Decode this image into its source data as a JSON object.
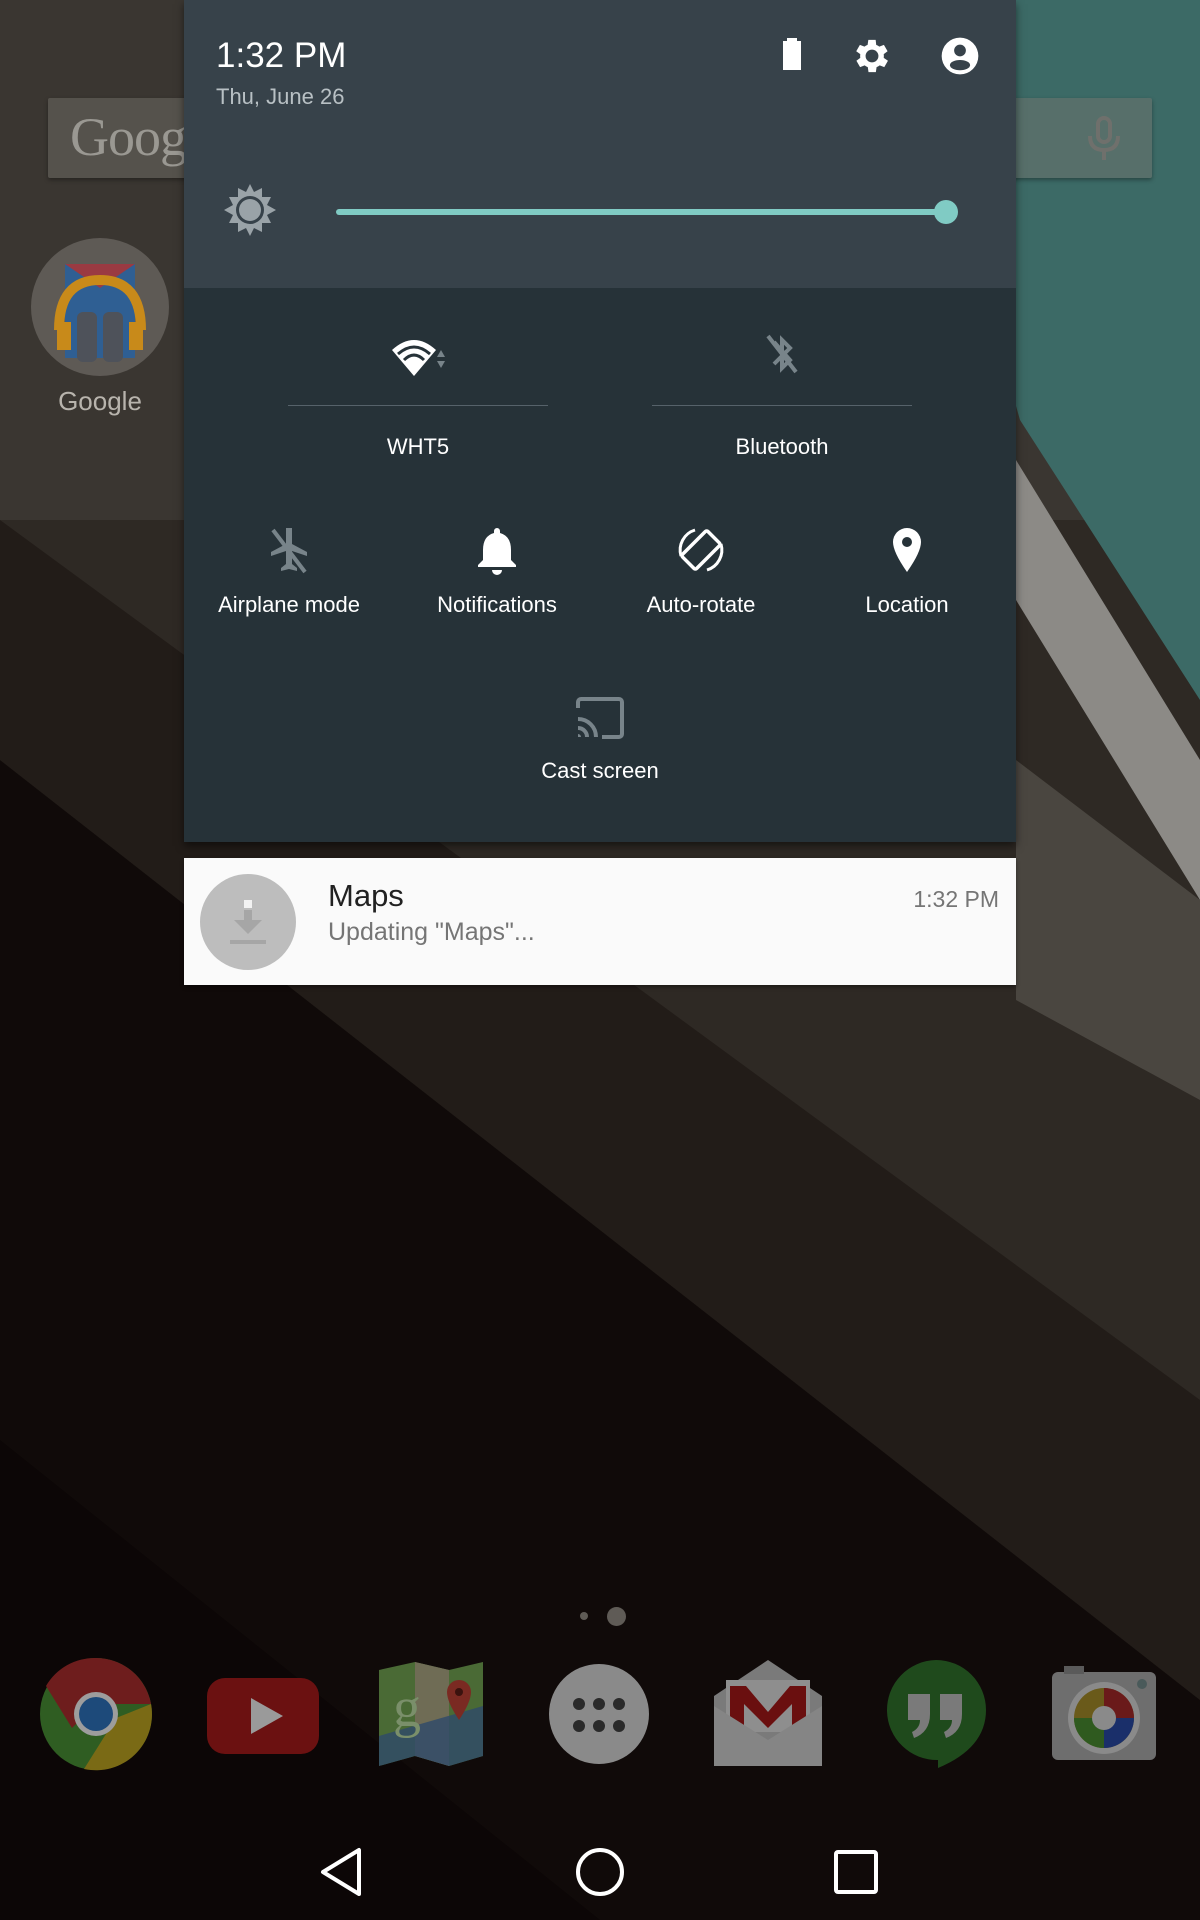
{
  "home": {
    "search_logo": "Goog",
    "app_shortcut_label": "Google",
    "page_indicator": {
      "count": 2,
      "current": 2
    },
    "dock": [
      {
        "name": "chrome",
        "icon": "chrome-icon"
      },
      {
        "name": "youtube",
        "icon": "youtube-icon"
      },
      {
        "name": "maps",
        "icon": "maps-icon"
      },
      {
        "name": "app-drawer",
        "icon": "app-drawer-icon"
      },
      {
        "name": "gmail",
        "icon": "gmail-icon"
      },
      {
        "name": "hangouts",
        "icon": "hangouts-icon"
      },
      {
        "name": "camera",
        "icon": "camera-icon"
      }
    ]
  },
  "quick_settings": {
    "time": "1:32 PM",
    "date": "Thu, June 26",
    "header_icons": [
      "battery-icon",
      "settings-icon",
      "account-icon"
    ],
    "brightness": {
      "level_percent": 100
    },
    "wide_tiles": [
      {
        "label": "WHT5",
        "icon": "wifi-icon",
        "active": true
      },
      {
        "label": "Bluetooth",
        "icon": "bluetooth-off-icon",
        "active": false
      }
    ],
    "tiles": [
      {
        "label": "Airplane mode",
        "icon": "airplane-off-icon",
        "active": false
      },
      {
        "label": "Notifications",
        "icon": "bell-icon",
        "active": true
      },
      {
        "label": "Auto-rotate",
        "icon": "rotate-icon",
        "active": true
      },
      {
        "label": "Location",
        "icon": "location-icon",
        "active": true
      },
      {
        "label": "Cast screen",
        "icon": "cast-icon",
        "active": false
      }
    ],
    "colors": {
      "accent": "#80cbc4",
      "panel_bg": "#263238",
      "header_bg": "#37424a"
    }
  },
  "notification": {
    "title": "Maps",
    "text": "Updating \"Maps\"...",
    "time": "1:32 PM",
    "icon": "download-icon"
  },
  "navbar": {
    "buttons": [
      "back-icon",
      "home-icon",
      "recents-icon"
    ]
  }
}
